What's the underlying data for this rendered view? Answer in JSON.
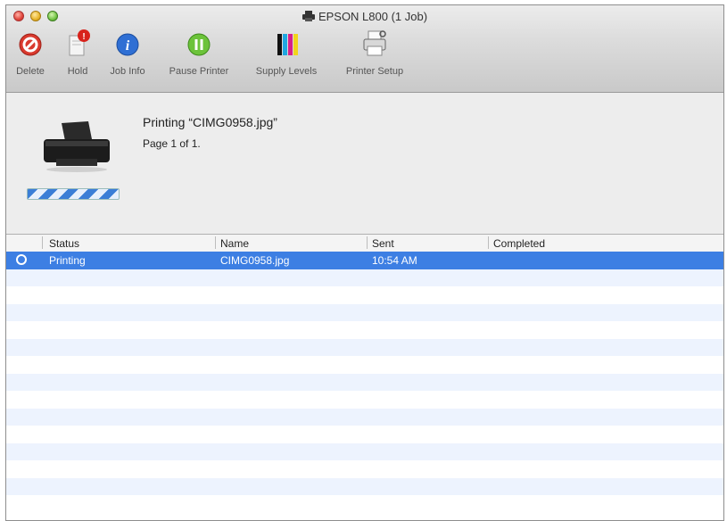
{
  "window": {
    "title": "EPSON L800 (1 Job)"
  },
  "toolbar": {
    "items": [
      {
        "label": "Delete",
        "icon": "delete-icon"
      },
      {
        "label": "Hold",
        "icon": "hold-icon"
      },
      {
        "label": "Job Info",
        "icon": "info-icon"
      },
      {
        "label": "Pause Printer",
        "icon": "pause-icon"
      },
      {
        "label": "Supply Levels",
        "icon": "ink-levels-icon"
      },
      {
        "label": "Printer Setup",
        "icon": "printer-setup-icon"
      }
    ]
  },
  "job": {
    "title": "Printing “CIMG0958.jpg”",
    "page": "Page 1 of 1."
  },
  "table": {
    "columns": [
      "Status",
      "Name",
      "Sent",
      "Completed"
    ],
    "rows": [
      {
        "status": "Printing",
        "name": "CIMG0958.jpg",
        "sent": "10:54 AM",
        "completed": ""
      }
    ]
  },
  "colors": {
    "selection": "#3d7fe3",
    "stripe": "#edf3fe"
  }
}
